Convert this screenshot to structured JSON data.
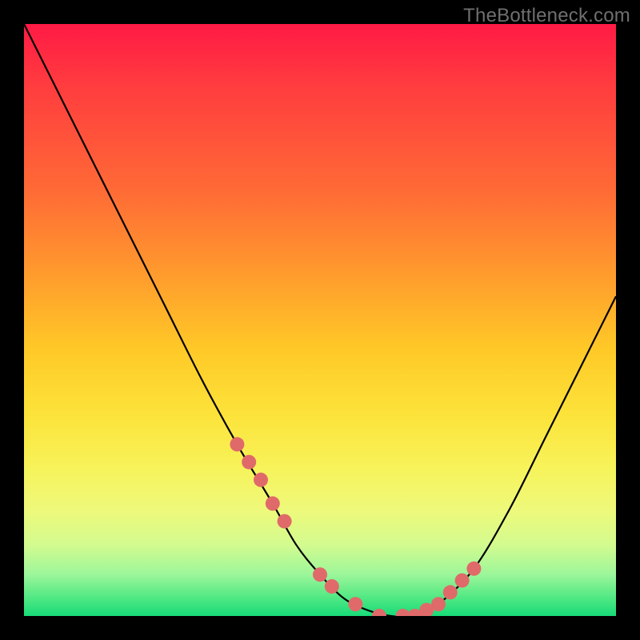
{
  "watermark": "TheBottleneck.com",
  "chart_data": {
    "type": "line",
    "title": "",
    "xlabel": "",
    "ylabel": "",
    "xlim": [
      0,
      100
    ],
    "ylim": [
      0,
      100
    ],
    "series": [
      {
        "name": "bottleneck-curve",
        "x": [
          0,
          6,
          12,
          18,
          24,
          30,
          36,
          42,
          46,
          50,
          54,
          58,
          62,
          66,
          70,
          76,
          82,
          88,
          94,
          100
        ],
        "y": [
          100,
          88,
          76,
          64,
          52,
          40,
          29,
          19,
          12,
          7,
          3,
          1,
          0,
          0,
          2,
          8,
          18,
          30,
          42,
          54
        ]
      }
    ],
    "highlight_dots": {
      "name": "highlight",
      "color": "#e06a6a",
      "x": [
        36,
        38,
        40,
        42,
        44,
        50,
        52,
        56,
        60,
        64,
        66,
        68,
        70,
        72,
        74,
        76
      ],
      "y": [
        29,
        26,
        23,
        19,
        16,
        7,
        5,
        2,
        0,
        0,
        0,
        1,
        2,
        4,
        6,
        8
      ]
    }
  }
}
